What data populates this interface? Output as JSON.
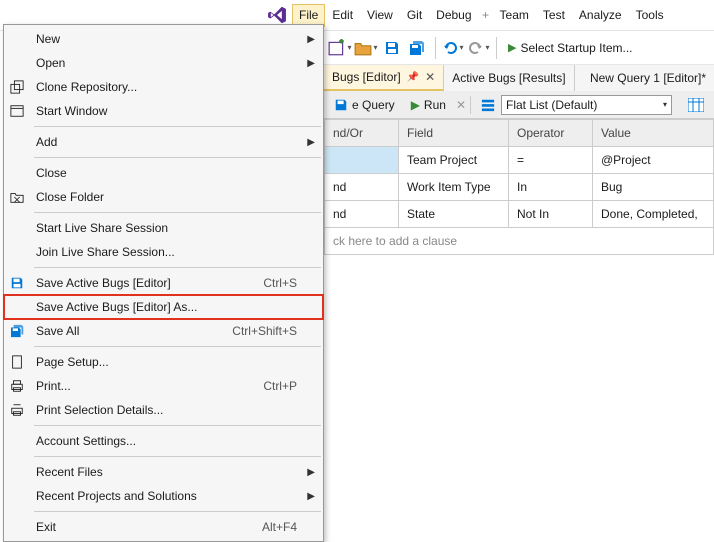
{
  "menubar": {
    "items": [
      "File",
      "Edit",
      "View",
      "Git",
      "Debug",
      "Team",
      "Test",
      "Analyze",
      "Tools"
    ]
  },
  "toolbar": {
    "startup_label": "Select Startup Item..."
  },
  "tabs": [
    {
      "label": "Bugs [Editor]",
      "active": true,
      "pinned": true
    },
    {
      "label": "Active Bugs [Results]",
      "active": false
    },
    {
      "label": "New Query 1 [Editor]*",
      "active": false
    }
  ],
  "querybar": {
    "save_label": "e Query",
    "run_label": "Run",
    "listtype_label": "Flat List (Default)"
  },
  "grid": {
    "headers": [
      "nd/Or",
      "Field",
      "Operator",
      "Value"
    ],
    "rows": [
      {
        "andor": "",
        "field": "Team Project",
        "op": "=",
        "value": "@Project",
        "selected": true
      },
      {
        "andor": "nd",
        "field": "Work Item Type",
        "op": "In",
        "value": "Bug"
      },
      {
        "andor": "nd",
        "field": "State",
        "op": "Not In",
        "value": "Done, Completed,"
      }
    ],
    "ghost": "ck here to add a clause"
  },
  "filemenu": {
    "items": [
      {
        "label": "New",
        "submenu": true
      },
      {
        "label": "Open",
        "submenu": true
      },
      {
        "label": "Clone Repository...",
        "icon": "clone"
      },
      {
        "label": "Start Window",
        "icon": "window"
      },
      {
        "sep": true
      },
      {
        "label": "Add",
        "submenu": true
      },
      {
        "sep": true
      },
      {
        "label": "Close"
      },
      {
        "label": "Close Folder",
        "icon": "closefolder"
      },
      {
        "sep": true
      },
      {
        "label": "Start Live Share Session"
      },
      {
        "label": "Join Live Share Session..."
      },
      {
        "sep": true
      },
      {
        "label": "Save Active Bugs [Editor]",
        "shortcut": "Ctrl+S",
        "icon": "save"
      },
      {
        "label": "Save Active Bugs [Editor] As...",
        "highlight": true
      },
      {
        "label": "Save All",
        "shortcut": "Ctrl+Shift+S",
        "icon": "saveall"
      },
      {
        "sep": true
      },
      {
        "label": "Page Setup...",
        "icon": "page"
      },
      {
        "label": "Print...",
        "shortcut": "Ctrl+P",
        "icon": "print"
      },
      {
        "label": "Print Selection Details...",
        "icon": "printsel"
      },
      {
        "sep": true
      },
      {
        "label": "Account Settings..."
      },
      {
        "sep": true
      },
      {
        "label": "Recent Files",
        "submenu": true
      },
      {
        "label": "Recent Projects and Solutions",
        "submenu": true
      },
      {
        "sep": true
      },
      {
        "label": "Exit",
        "shortcut": "Alt+F4"
      }
    ]
  }
}
